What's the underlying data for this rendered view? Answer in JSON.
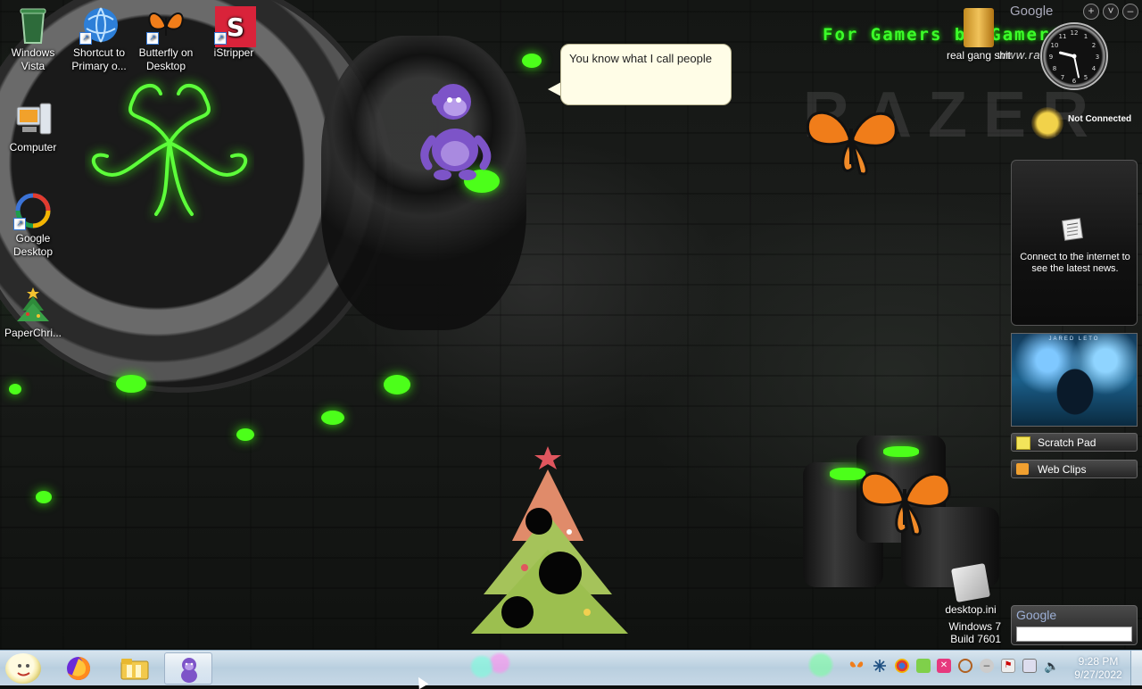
{
  "desktop_icons": [
    {
      "label": "Windows Vista",
      "icon": "recycle-bin-icon"
    },
    {
      "label": "Shortcut to Primary o...",
      "icon": "globe-shortcut-icon"
    },
    {
      "label": "Butterfly on Desktop",
      "icon": "butterfly-icon"
    },
    {
      "label": "iStripper",
      "icon": "istripper-icon"
    },
    {
      "label": "Computer",
      "icon": "computer-icon"
    },
    {
      "label": "Google Desktop",
      "icon": "google-desktop-icon"
    },
    {
      "label": "PaperChri...",
      "icon": "christmas-tree-icon"
    }
  ],
  "speech_bubble": {
    "text": "You know what I call people"
  },
  "wallpaper": {
    "gamer_text": "For Gamers by Gamers",
    "url_text": "www.razer",
    "accent_color": "#3cff2a"
  },
  "folder_icon": {
    "label": "real gang shit"
  },
  "gadgets": {
    "google_label": "Google",
    "weather_status": "Not Connected",
    "news_message": "Connect to the internet to see the latest news.",
    "slideshow_caption": "JARED LETO",
    "scratch_pad_label": "Scratch Pad",
    "web_clips_label": "Web Clips",
    "search_logo": "Google",
    "search_value": "",
    "clock": {
      "hour": 9,
      "minute": 28
    }
  },
  "desktop_ini": {
    "label": "desktop.ini"
  },
  "windows_version": {
    "line1": "Windows 7",
    "line2": "Build 7601"
  },
  "taskbar": {
    "pinned": [
      "start-orb-icon",
      "firefox-icon",
      "explorer-folder-icon",
      "bonzi-icon"
    ],
    "active_item": "bonzi-icon",
    "time": "9:28 PM",
    "date": "9/27/2022"
  }
}
